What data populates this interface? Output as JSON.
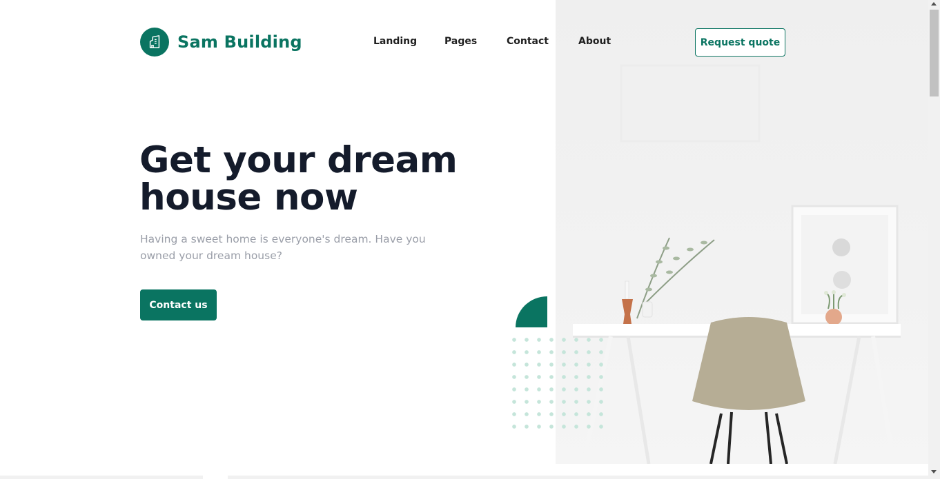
{
  "brand": {
    "name": "Sam Building",
    "color": "#0a7461"
  },
  "nav": {
    "items": [
      {
        "label": "Landing"
      },
      {
        "label": "Pages"
      },
      {
        "label": "Contact"
      },
      {
        "label": "About"
      }
    ],
    "quote_label": "Request quote"
  },
  "hero": {
    "title_line1": "Get your dream",
    "title_line2": "house now",
    "subtitle": "Having a sweet home is everyone's dream. Have you owned your dream house?",
    "cta_label": "Contact us",
    "image": "white desk with beige chair, plant vases and framed art"
  },
  "icons": {
    "logo": "building-icon"
  },
  "colors": {
    "accent": "#0a7461",
    "heading": "#141b2b",
    "muted_text": "#9a9ea8",
    "dots": "#c5e5da"
  }
}
